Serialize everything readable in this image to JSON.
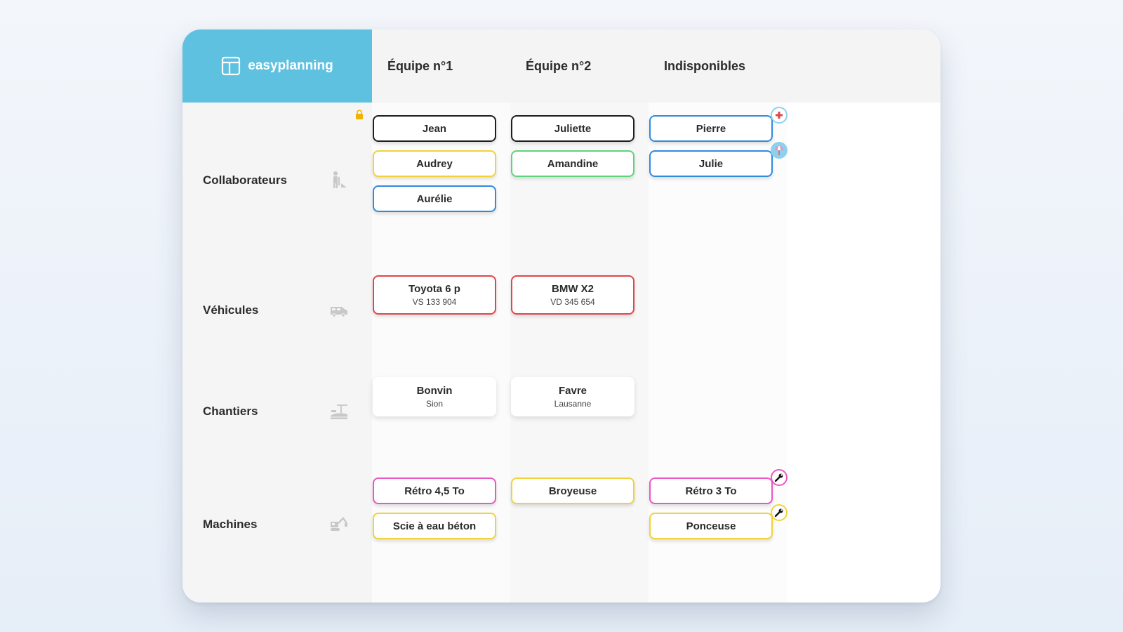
{
  "app": {
    "name": "easyplanning",
    "brand_color": "#5ec1e0"
  },
  "columns": [
    {
      "label": "Équipe n°1"
    },
    {
      "label": "Équipe n°2"
    },
    {
      "label": "Indisponibles"
    }
  ],
  "rows": [
    {
      "label": "Collaborateurs",
      "icon": "worker-icon"
    },
    {
      "label": "Véhicules",
      "icon": "van-icon"
    },
    {
      "label": "Chantiers",
      "icon": "construction-site-icon"
    },
    {
      "label": "Machines",
      "icon": "excavator-icon"
    }
  ],
  "cards": {
    "collaborateurs": {
      "jean": "Jean",
      "audrey": "Audrey",
      "aurelie": "Aurélie",
      "juliette": "Juliette",
      "amandine": "Amandine",
      "pierre": "Pierre",
      "julie": "Julie"
    },
    "vehicules": {
      "toyota": {
        "name": "Toyota 6 p",
        "plate": "VS 133 904"
      },
      "bmw": {
        "name": "BMW X2",
        "plate": "VD 345 654"
      }
    },
    "chantiers": {
      "bonvin": {
        "name": "Bonvin",
        "place": "Sion"
      },
      "favre": {
        "name": "Favre",
        "place": "Lausanne"
      }
    },
    "machines": {
      "retro45": "Rétro 4,5 To",
      "scie": "Scie à eau béton",
      "broyeuse": "Broyeuse",
      "retro3": "Rétro 3 To",
      "ponceuse": "Ponceuse"
    }
  },
  "status_icons": {
    "pierre": "medical-cross-icon",
    "julie": "beach-umbrella-icon",
    "retro3": "wrench-icon",
    "ponceuse": "wrench-icon"
  },
  "colors": {
    "black": "#1e1e1e",
    "yellow": "#f2d23a",
    "blue": "#2f8be0",
    "green": "#5fd37b",
    "red": "#e2454a",
    "pink": "#ea56c3"
  }
}
